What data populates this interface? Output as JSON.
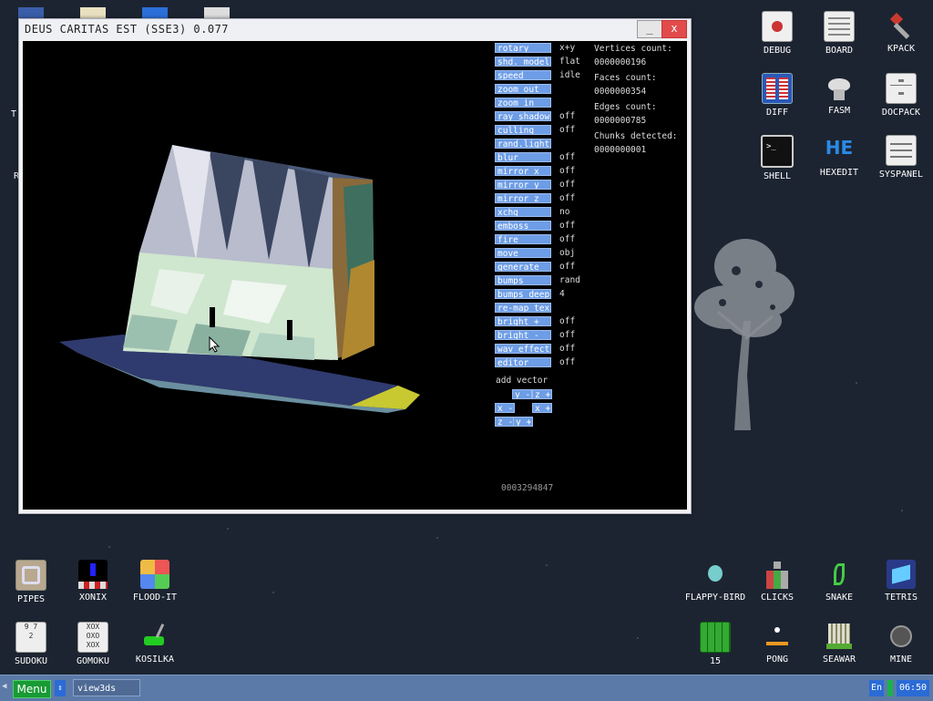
{
  "window": {
    "title": "DEUS CARITAS EST (SSE3) 0.077",
    "minimize": "_",
    "close": "x"
  },
  "menu_buttons": [
    {
      "label": "rotary",
      "value": "x+y"
    },
    {
      "label": "shd. model",
      "value": "flat"
    },
    {
      "label": "speed",
      "value": "idle"
    },
    {
      "label": "zoom out",
      "value": ""
    },
    {
      "label": "zoom in",
      "value": ""
    },
    {
      "label": "ray shadow",
      "value": "off"
    },
    {
      "label": "culling",
      "value": "off"
    },
    {
      "label": "rand.light",
      "value": ""
    },
    {
      "label": "blur",
      "value": "off"
    },
    {
      "label": "mirror x",
      "value": "off"
    },
    {
      "label": "mirror y",
      "value": "off"
    },
    {
      "label": "mirror z",
      "value": "off"
    },
    {
      "label": "xchg",
      "value": "no"
    },
    {
      "label": "emboss",
      "value": "off"
    },
    {
      "label": "fire",
      "value": "off"
    },
    {
      "label": "move",
      "value": "obj"
    },
    {
      "label": "generate",
      "value": "off"
    },
    {
      "label": "bumps",
      "value": "rand"
    },
    {
      "label": "bumps deep",
      "value": "4"
    },
    {
      "label": "re-map tex",
      "value": ""
    },
    {
      "label": "bright +",
      "value": "off"
    },
    {
      "label": "bright -",
      "value": "off"
    },
    {
      "label": "wav effect",
      "value": "off"
    },
    {
      "label": "editor",
      "value": "off"
    }
  ],
  "add_vector": {
    "label": "add vector",
    "y_minus": "y -",
    "z_plus": "z +",
    "x_minus": "x -",
    "x_plus": "x +",
    "z_minus": "z -",
    "y_plus": "y +"
  },
  "stats": {
    "vertices_label": "Vertices count:",
    "vertices_value": "0000000196",
    "faces_label": "Faces count:",
    "faces_value": "0000000354",
    "edges_label": "Edges count:",
    "edges_value": "0000000785",
    "chunks_label": "Chunks detected:",
    "chunks_value": "0000000001"
  },
  "counter": "0003294847",
  "desktop_icons_right": [
    {
      "label": "DEBUG",
      "icon": "debug-icon"
    },
    {
      "label": "BOARD",
      "icon": "board-icon"
    },
    {
      "label": "KPACK",
      "icon": "kpack-icon"
    },
    {
      "label": "DIFF",
      "icon": "diff-icon"
    },
    {
      "label": "FASM",
      "icon": "fasm-icon"
    },
    {
      "label": "DOCPACK",
      "icon": "docpack-icon"
    },
    {
      "label": "SHELL",
      "icon": "shell-icon"
    },
    {
      "label": "HEXEDIT",
      "icon": "hexedit-icon"
    },
    {
      "label": "SYSPANEL",
      "icon": "syspanel-icon"
    }
  ],
  "desktop_icons_bottom_left": [
    {
      "label": "PIPES",
      "icon": "pipes-icon"
    },
    {
      "label": "XONIX",
      "icon": "xonix-icon"
    },
    {
      "label": "FLOOD-IT",
      "icon": "flood-it-icon"
    },
    {
      "label": "SUDOKU",
      "icon": "sudoku-icon"
    },
    {
      "label": "GOMOKU",
      "icon": "gomoku-icon"
    },
    {
      "label": "KOSILKA",
      "icon": "kosilka-icon"
    }
  ],
  "desktop_icons_bottom_right": [
    {
      "label": "FLAPPY-BIRD",
      "icon": "flappy-bird-icon"
    },
    {
      "label": "CLICKS",
      "icon": "clicks-icon"
    },
    {
      "label": "SNAKE",
      "icon": "snake-icon"
    },
    {
      "label": "TETRIS",
      "icon": "tetris-icon"
    },
    {
      "label": "15",
      "icon": "fifteen-icon"
    },
    {
      "label": "PONG",
      "icon": "pong-icon"
    },
    {
      "label": "SEAWAR",
      "icon": "seawar-icon"
    },
    {
      "label": "MINE",
      "icon": "mine-icon"
    }
  ],
  "left_edge_letters": [
    "T",
    "R"
  ],
  "taskbar": {
    "menu": "Menu",
    "task": "view3ds",
    "lang": "En",
    "clock": "06:50"
  }
}
